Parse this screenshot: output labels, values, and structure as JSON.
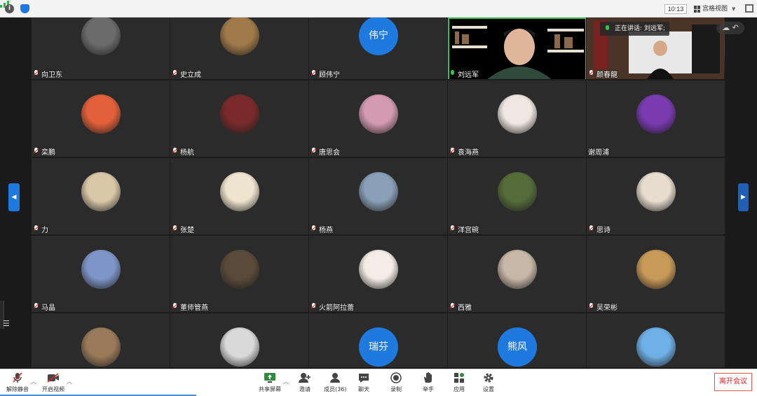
{
  "topbar": {
    "info_icon": "info-icon",
    "shield_icon": "shield-icon",
    "signal_icon": "signal-icon",
    "time": "10:13",
    "view_mode": "宫格视图",
    "fullscreen_icon": "fullscreen-icon"
  },
  "speaking": {
    "label": "正在讲话: 刘远军;"
  },
  "participants": [
    {
      "name": "向卫东",
      "avatar": "photo",
      "color": "#6b6b6b"
    },
    {
      "name": "史立成",
      "avatar": "photo",
      "color": "#a07a4a"
    },
    {
      "name": "顾伟宁",
      "avatar": "text",
      "initials": "伟宁"
    },
    {
      "name": "刘远军",
      "avatar": "video",
      "mic": "on"
    },
    {
      "name": "颜春龍",
      "avatar": "video"
    },
    {
      "name": "栾鹏",
      "avatar": "photo",
      "color": "#e2603a"
    },
    {
      "name": "杨航",
      "avatar": "photo",
      "color": "#7a2a2a"
    },
    {
      "name": "唐思会",
      "avatar": "photo",
      "color": "#d49bb0"
    },
    {
      "name": "袁海燕",
      "avatar": "photo",
      "color": "#f0e8e0"
    },
    {
      "name": "谢周浦",
      "avatar": "photo",
      "color": "#7a3ab0",
      "no_mic": true
    },
    {
      "name": "力",
      "avatar": "photo",
      "color": "#d8c8a8"
    },
    {
      "name": "张楚",
      "avatar": "photo",
      "color": "#efe4cf"
    },
    {
      "name": "杨燕",
      "avatar": "photo",
      "color": "#8aa0b8"
    },
    {
      "name": "洋宫碗",
      "avatar": "photo",
      "color": "#556b3a"
    },
    {
      "name": "思诗",
      "avatar": "photo",
      "color": "#e8ddd0"
    },
    {
      "name": "马晶",
      "avatar": "photo",
      "color": "#7f95c8"
    },
    {
      "name": "董师管燕",
      "avatar": "photo",
      "color": "#5a4a3a"
    },
    {
      "name": "火箭阿拉蕾",
      "avatar": "photo",
      "color": "#f4ede6"
    },
    {
      "name": "西雅",
      "avatar": "photo",
      "color": "#c7b7a7"
    },
    {
      "name": "吴荣彬",
      "avatar": "photo",
      "color": "#c89a58"
    },
    {
      "name": "",
      "avatar": "photo",
      "color": "#9a7a5a"
    },
    {
      "name": "",
      "avatar": "photo",
      "color": "#d9d9d9"
    },
    {
      "name": "",
      "avatar": "text",
      "initials": "瑞芬"
    },
    {
      "name": "",
      "avatar": "text",
      "initials": "熊风"
    },
    {
      "name": "",
      "avatar": "photo",
      "color": "#6fb0e6"
    }
  ],
  "toolbar": {
    "mute": "解除静音",
    "video": "开启视频",
    "share": "共享屏幕",
    "invite": "邀请",
    "members": "成员(36)",
    "chat": "聊天",
    "record": "录制",
    "raise_hand": "举手",
    "apps": "应用",
    "settings": "设置",
    "leave": "离开会议"
  },
  "colors": {
    "accent": "#1f7ae0",
    "leave": "#e02424",
    "tile_bg": "#2b2b2b"
  }
}
